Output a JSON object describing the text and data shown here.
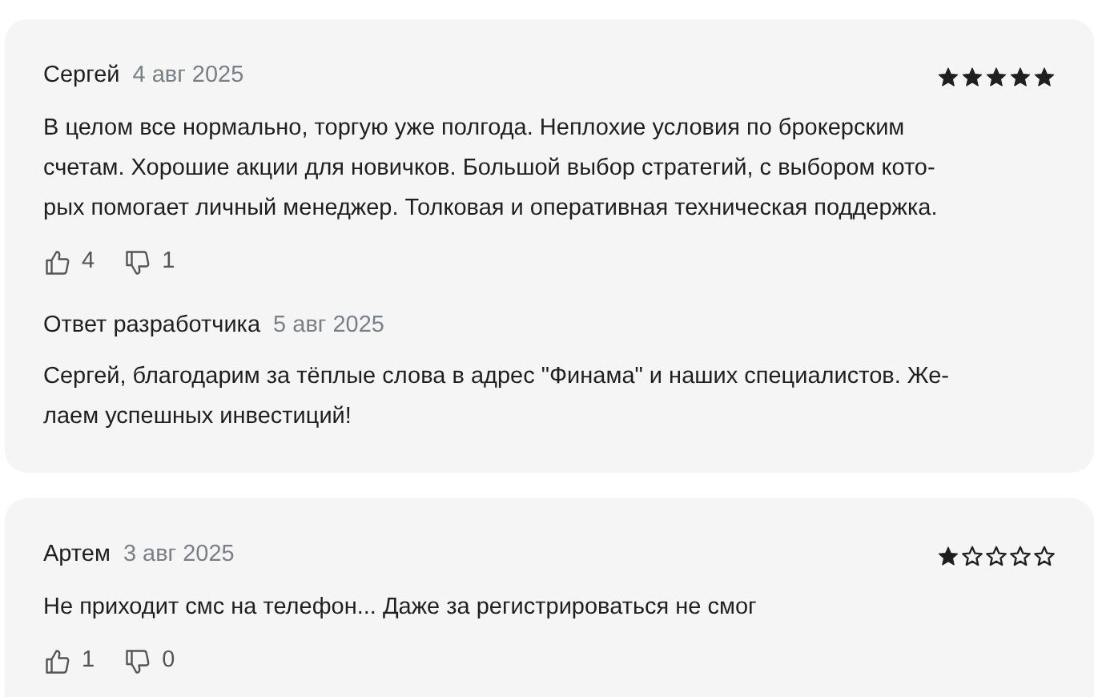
{
  "reviews": [
    {
      "author": "Сергей",
      "date": "4 авг 2025",
      "stars": 5,
      "text": "В целом все нормально, торгую уже полгода. Неплохие условия по брокерским\nсчетам. Хорошие акции для новичков. Большой выбор стратегий, с выбором кото-\nрых помогает личный менеджер. Толковая и оперативная техническая поддержка.",
      "likes": "4",
      "dislikes": "1",
      "reply": {
        "title": "Ответ разработчика",
        "date": "5 авг 2025",
        "text": "Сергей, благодарим за тёплые слова в адрес \"Финама\" и наших специалистов. Же-\nлаем успешных инвестиций!"
      }
    },
    {
      "author": "Артем",
      "date": "3 авг 2025",
      "stars": 1,
      "text": "Не приходит смс на телефон... Даже за регистрироваться не смог",
      "likes": "1",
      "dislikes": "0"
    }
  ]
}
